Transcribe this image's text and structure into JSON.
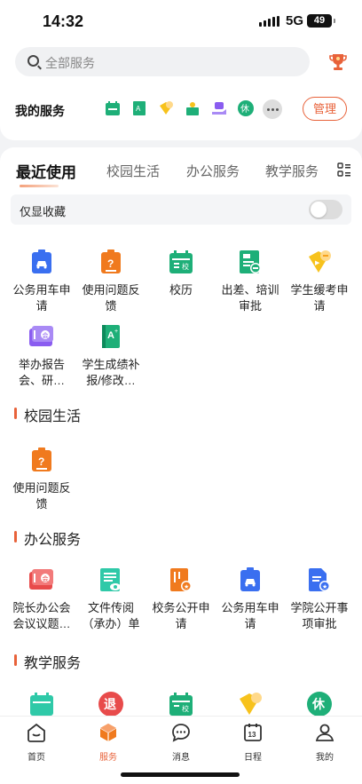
{
  "status": {
    "time": "14:32",
    "network": "5G",
    "battery": "49"
  },
  "search": {
    "placeholder": "全部服务"
  },
  "my_services": {
    "label": "我的服务",
    "manage": "管理"
  },
  "tabs": [
    "最近使用",
    "校园生活",
    "办公服务",
    "教学服务"
  ],
  "only_fav": "仅显收藏",
  "recent": [
    {
      "label": "公务用车申请",
      "icon": "car-icon"
    },
    {
      "label": "使用问题反馈",
      "icon": "feedback-icon"
    },
    {
      "label": "校历",
      "icon": "calendar-icon"
    },
    {
      "label": "出差、培训审批",
      "icon": "trip-approval-icon"
    },
    {
      "label": "学生缓考申请",
      "icon": "exam-defer-icon"
    },
    {
      "label": "举办报告会、研…",
      "icon": "report-meeting-icon"
    },
    {
      "label": "学生成绩补报/修改…",
      "icon": "grade-icon"
    }
  ],
  "sections": {
    "campus": {
      "title": "校园生活",
      "items": [
        {
          "label": "使用问题反馈",
          "icon": "feedback-icon"
        }
      ]
    },
    "office": {
      "title": "办公服务",
      "items": [
        {
          "label": "院长办公会会议议题…",
          "icon": "meeting-topic-icon"
        },
        {
          "label": "文件传阅（承办）单",
          "icon": "document-icon"
        },
        {
          "label": "校务公开申请",
          "icon": "disclosure-icon"
        },
        {
          "label": "公务用车申请",
          "icon": "car-icon"
        },
        {
          "label": "学院公开事项审批",
          "icon": "college-disclosure-icon"
        }
      ]
    },
    "teaching": {
      "title": "教学服务",
      "badges": {
        "retreat": "退",
        "rest": "休"
      }
    }
  },
  "tabbar": [
    {
      "label": "首页"
    },
    {
      "label": "服务"
    },
    {
      "label": "消息"
    },
    {
      "label": "日程",
      "day": "13"
    },
    {
      "label": "我的"
    }
  ],
  "colors": {
    "accent": "#e8623a",
    "blue": "#3a6ff0",
    "orange": "#f07a1e",
    "green": "#1eaf78",
    "purple": "#8a5cf0",
    "yellow": "#f7c21c",
    "red": "#e84b4b",
    "teal": "#2fc9a8"
  }
}
